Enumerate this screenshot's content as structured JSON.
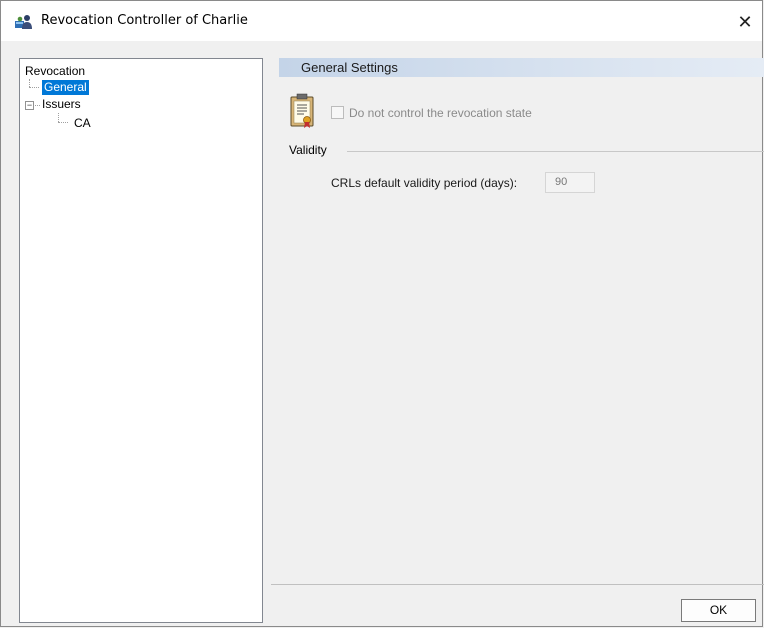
{
  "window": {
    "title": "Revocation Controller of Charlie",
    "close_glyph": "✕"
  },
  "tree": {
    "root": "Revocation",
    "items": [
      {
        "label": "General",
        "selected": true
      },
      {
        "label": "Issuers",
        "expander": "−",
        "children": [
          {
            "label": "CA"
          }
        ]
      }
    ]
  },
  "panel": {
    "section_title": "General Settings",
    "checkbox_label": "Do not control the revocation state",
    "checkbox_checked": false,
    "group_title": "Validity",
    "field_label": "CRLs default validity period (days):",
    "field_value": "90"
  },
  "buttons": {
    "ok": "OK"
  },
  "colors": {
    "selection": "#0078d7",
    "header_gradient_start": "#c4d4e8"
  }
}
